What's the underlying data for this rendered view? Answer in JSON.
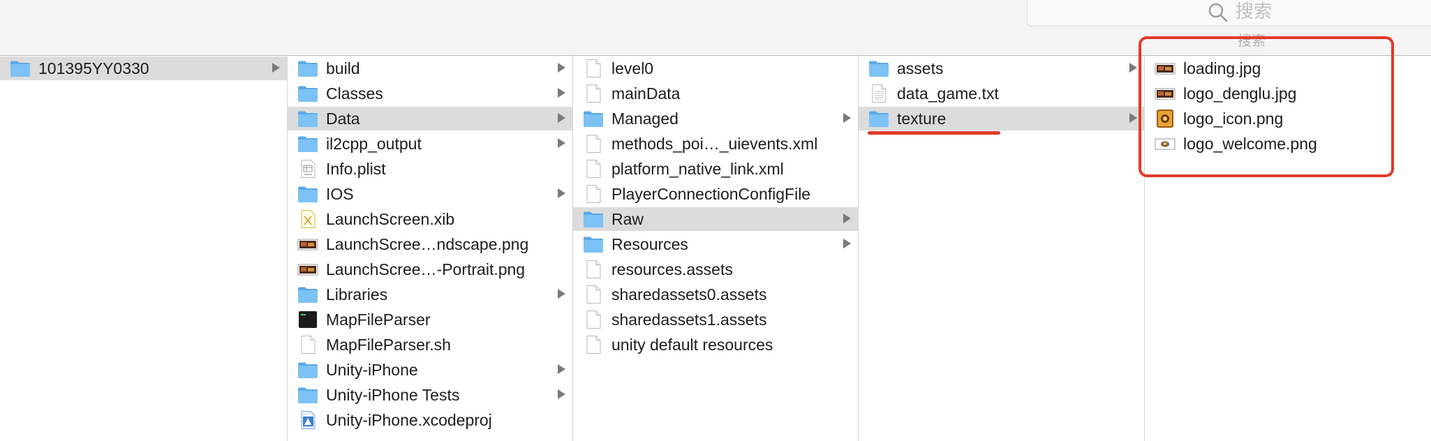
{
  "search": {
    "placeholder": "搜索",
    "caption": "搜索"
  },
  "colors": {
    "folder": "#7dc2f4",
    "selection": "#dcdcdc",
    "annotation": "#e23a2a"
  },
  "columns": [
    {
      "items": [
        {
          "label": "101395YY0330",
          "icon": "folder-icon",
          "folder": true,
          "selected": true
        }
      ]
    },
    {
      "items": [
        {
          "label": "build",
          "icon": "folder-icon",
          "folder": true
        },
        {
          "label": "Classes",
          "icon": "folder-icon",
          "folder": true
        },
        {
          "label": "Data",
          "icon": "folder-icon",
          "folder": true,
          "selected": true
        },
        {
          "label": "il2cpp_output",
          "icon": "folder-icon",
          "folder": true
        },
        {
          "label": "Info.plist",
          "icon": "plist-file-icon"
        },
        {
          "label": "IOS",
          "icon": "folder-icon",
          "folder": true
        },
        {
          "label": "LaunchScreen.xib",
          "icon": "xib-file-icon"
        },
        {
          "label": "LaunchScree…ndscape.png",
          "icon": "image-thumbnail-icon"
        },
        {
          "label": "LaunchScree…-Portrait.png",
          "icon": "image-thumbnail-icon"
        },
        {
          "label": "Libraries",
          "icon": "folder-icon",
          "folder": true
        },
        {
          "label": "MapFileParser",
          "icon": "terminal-executable-icon"
        },
        {
          "label": "MapFileParser.sh",
          "icon": "document-icon"
        },
        {
          "label": "Unity-iPhone",
          "icon": "folder-icon",
          "folder": true
        },
        {
          "label": "Unity-iPhone Tests",
          "icon": "folder-icon",
          "folder": true
        },
        {
          "label": "Unity-iPhone.xcodeproj",
          "icon": "xcodeproj-icon"
        }
      ]
    },
    {
      "items": [
        {
          "label": "level0",
          "icon": "document-icon"
        },
        {
          "label": "mainData",
          "icon": "document-icon"
        },
        {
          "label": "Managed",
          "icon": "folder-icon",
          "folder": true
        },
        {
          "label": "methods_poi…_uievents.xml",
          "icon": "document-icon"
        },
        {
          "label": "platform_native_link.xml",
          "icon": "document-icon"
        },
        {
          "label": "PlayerConnectionConfigFile",
          "icon": "document-icon"
        },
        {
          "label": "Raw",
          "icon": "folder-icon",
          "folder": true,
          "selected": true
        },
        {
          "label": "Resources",
          "icon": "folder-icon",
          "folder": true
        },
        {
          "label": "resources.assets",
          "icon": "document-icon"
        },
        {
          "label": "sharedassets0.assets",
          "icon": "document-icon"
        },
        {
          "label": "sharedassets1.assets",
          "icon": "document-icon"
        },
        {
          "label": "unity default resources",
          "icon": "document-icon"
        }
      ]
    },
    {
      "items": [
        {
          "label": "assets",
          "icon": "folder-icon",
          "folder": true
        },
        {
          "label": "data_game.txt",
          "icon": "text-file-icon"
        },
        {
          "label": "texture",
          "icon": "folder-icon",
          "folder": true,
          "selected": true
        }
      ]
    },
    {
      "items": [
        {
          "label": "loading.jpg",
          "icon": "image-thumbnail-icon"
        },
        {
          "label": "logo_denglu.jpg",
          "icon": "image-thumbnail-icon"
        },
        {
          "label": "logo_icon.png",
          "icon": "app-logo-thumbnail-icon"
        },
        {
          "label": "logo_welcome.png",
          "icon": "small-image-thumbnail-icon"
        }
      ]
    }
  ]
}
